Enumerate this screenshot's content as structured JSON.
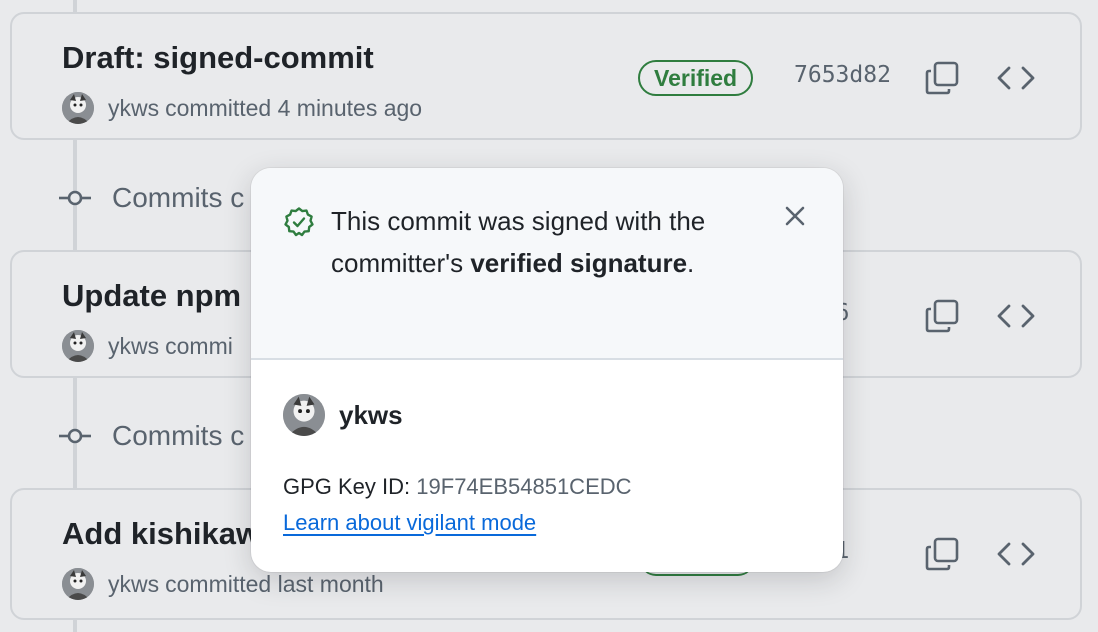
{
  "commits": [
    {
      "title": "Draft: signed-commit",
      "author": "ykws",
      "time": "committed 4 minutes ago",
      "badge": "Verified",
      "sha": "7653d82"
    },
    {
      "title": "Update npm",
      "author": "ykws",
      "time": "commi",
      "badge": "",
      "sha": "ac06"
    },
    {
      "title": "Add kishikaw",
      "author": "ykws",
      "time": "committed last month",
      "badge": "",
      "sha": "0d11"
    }
  ],
  "sections": [
    {
      "label": "Commits c"
    },
    {
      "label": "Commits c"
    }
  ],
  "popover": {
    "message_before": "This commit was signed with the committer's ",
    "message_bold": "verified signature",
    "message_after": ".",
    "username": "ykws",
    "gpg_label": "GPG Key ID:",
    "gpg_key": "19F74EB54851CEDC",
    "link": "Learn about vigilant mode"
  },
  "icons": {
    "check": "verified-check-icon",
    "close": "close-icon",
    "copy": "copy-icon",
    "code": "code-icon",
    "commit": "commit-node-icon"
  },
  "colors": {
    "verified": "#2f7d3f",
    "link": "#0969da",
    "background": "#e9eaec"
  }
}
